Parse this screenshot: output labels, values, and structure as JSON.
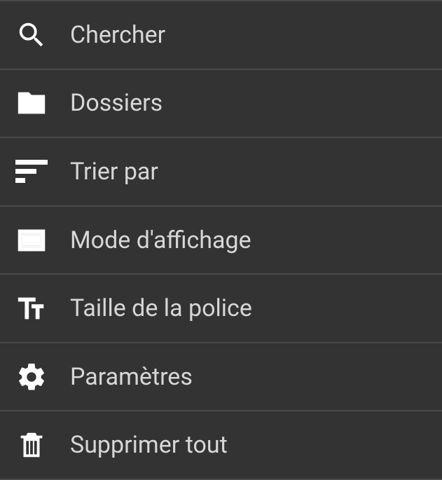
{
  "menu": {
    "items": [
      {
        "id": "search",
        "label": "Chercher",
        "icon": "search-icon"
      },
      {
        "id": "folders",
        "label": "Dossiers",
        "icon": "folder-icon"
      },
      {
        "id": "sort",
        "label": "Trier par",
        "icon": "sort-icon"
      },
      {
        "id": "display",
        "label": "Mode d'affichage",
        "icon": "display-mode-icon"
      },
      {
        "id": "fontsize",
        "label": "Taille de la police",
        "icon": "font-size-icon"
      },
      {
        "id": "settings",
        "label": "Paramètres",
        "icon": "gear-icon"
      },
      {
        "id": "deleteall",
        "label": "Supprimer tout",
        "icon": "trash-icon"
      }
    ]
  }
}
